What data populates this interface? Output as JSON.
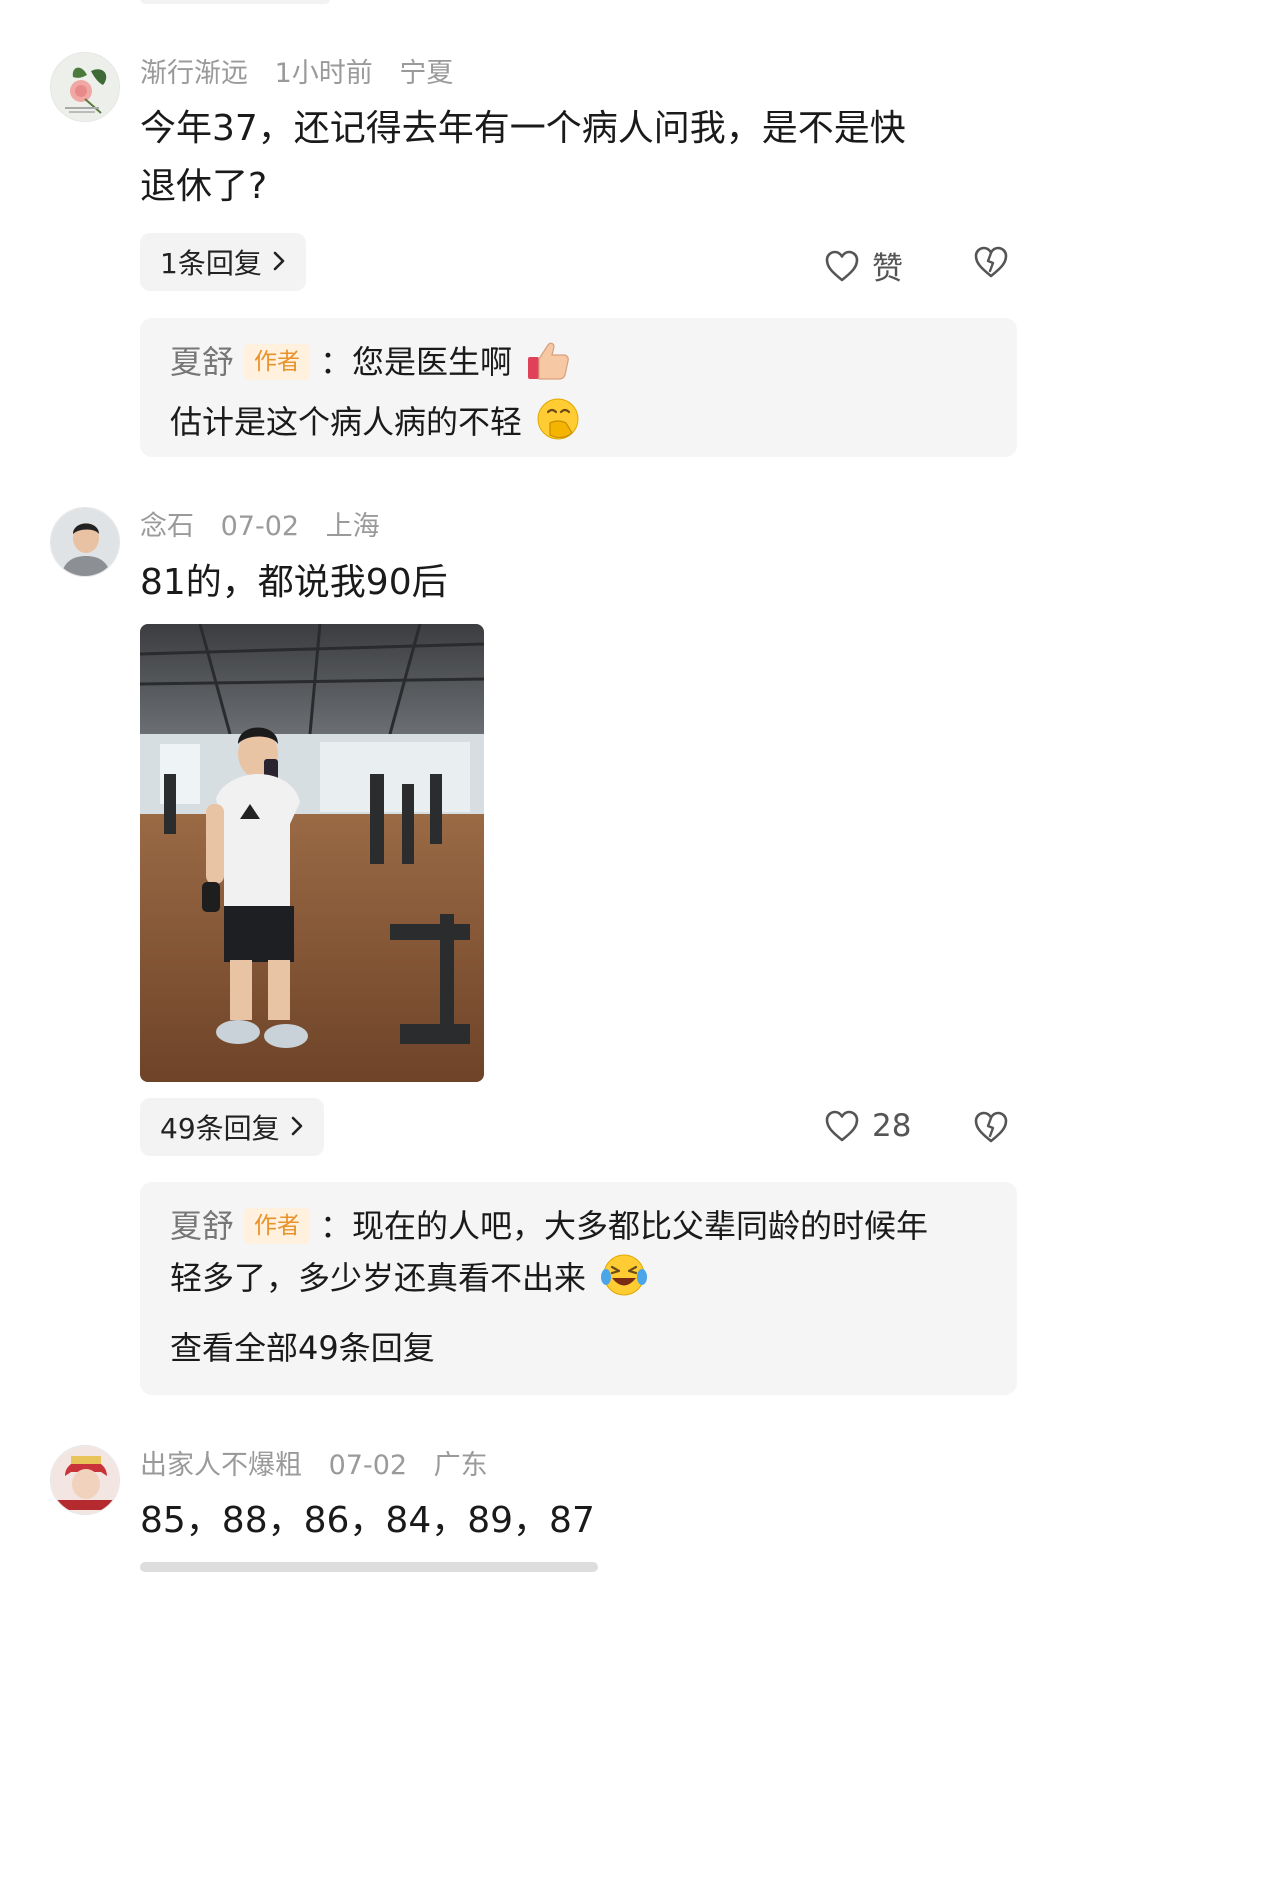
{
  "comments": [
    {
      "username": "渐行渐远",
      "time": "1小时前",
      "location": "宁夏",
      "text_line1": "今年37，还记得去年有一个病人问我，是不是快",
      "text_line2": "退休了?",
      "reply_count_label": "1条回复",
      "like_label": "赞",
      "author_reply": {
        "author": "夏舒",
        "badge": "作者",
        "line1": "：您是医生啊",
        "line2": "估计是这个病人病的不轻"
      }
    },
    {
      "username": "念石",
      "time": "07-02",
      "location": "上海",
      "text_line1": "81的，都说我90后",
      "reply_count_label": "49条回复",
      "like_label": "28",
      "author_reply": {
        "author": "夏舒",
        "badge": "作者",
        "line1": "：现在的人吧，大多都比父辈同龄的时候年",
        "line2": "轻多了，多少岁还真看不出来",
        "view_all": "查看全部49条回复"
      }
    },
    {
      "username": "出家人不爆粗",
      "time": "07-02",
      "location": "广东",
      "text_line1": "85，88，86，84，89，87"
    }
  ],
  "colors": {
    "meta_text": "#9a9a9a",
    "badge_bg": "#fff1de",
    "badge_text": "#e8922c",
    "reply_box_bg": "#f5f5f5"
  },
  "icons": [
    "heart-icon",
    "broken-heart-icon",
    "chevron-right-icon",
    "thumbs-up-emoji",
    "hand-over-mouth-emoji",
    "rolling-laughing-emoji"
  ]
}
